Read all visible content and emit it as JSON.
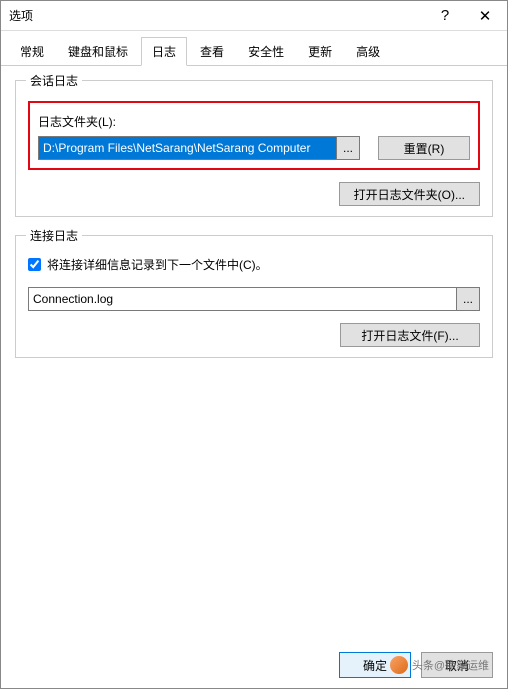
{
  "titlebar": {
    "title": "选项"
  },
  "tabs": [
    "常规",
    "键盘和鼠标",
    "日志",
    "查看",
    "安全性",
    "更新",
    "高级"
  ],
  "active_tab_index": 2,
  "session_log": {
    "group_title": "会话日志",
    "folder_label": "日志文件夹(L):",
    "folder_value": "D:\\Program Files\\NetSarang\\NetSarang Computer",
    "browse": "...",
    "reset": "重置(R)",
    "open_folder": "打开日志文件夹(O)..."
  },
  "connection_log": {
    "group_title": "连接日志",
    "checkbox_checked": true,
    "checkbox_label": "将连接详细信息记录到下一个文件中(C)。",
    "file_value": "Connection.log",
    "browse": "...",
    "open_file": "打开日志文件(F)..."
  },
  "footer": {
    "ok": "确定",
    "cancel": "取消"
  },
  "watermark": "头条@徐家运维"
}
